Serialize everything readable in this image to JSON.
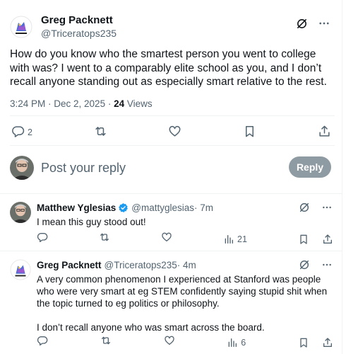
{
  "main_tweet": {
    "author_name": "Greg Packnett",
    "author_handle": "@Triceratops235",
    "text": "How do you know who the smartest person you went to college with was? I went to a comparably elite school as you, and I don’t recall anyone standing out as especially smart relative to the rest.",
    "time": "3:24 PM · Dec 2, 2025 · ",
    "views_count": "24",
    "views_label": " Views",
    "reply_count": "2"
  },
  "composer": {
    "placeholder": "Post your reply",
    "reply_button": "Reply"
  },
  "replies": [
    {
      "author_name": "Matthew Yglesias",
      "verified": true,
      "author_handle": "@mattyglesias",
      "time": " · 7m",
      "paragraphs": [
        "I mean this guy stood out!"
      ],
      "views": "21"
    },
    {
      "author_name": "Greg Packnett",
      "verified": false,
      "author_handle": "@Triceratops235",
      "time": " · 4m",
      "paragraphs": [
        "A very common phenomenon I experienced at Stanford was people who were very smart at eg STEM confidently saying stupid shit when the topic turned to eg politics or philosophy.",
        "",
        "I don’t recall anyone who was smart across the board."
      ],
      "views": "6"
    }
  ],
  "colors": {
    "text": "#0f1419",
    "secondary": "#536471",
    "verified_blue": "#1d9bf0",
    "reply_button_disabled": "#8f9ba3"
  },
  "icons": [
    "grok-icon",
    "more-icon",
    "reply-icon",
    "repost-icon",
    "like-icon",
    "views-icon",
    "bookmark-icon",
    "share-icon",
    "verified-badge-icon"
  ]
}
